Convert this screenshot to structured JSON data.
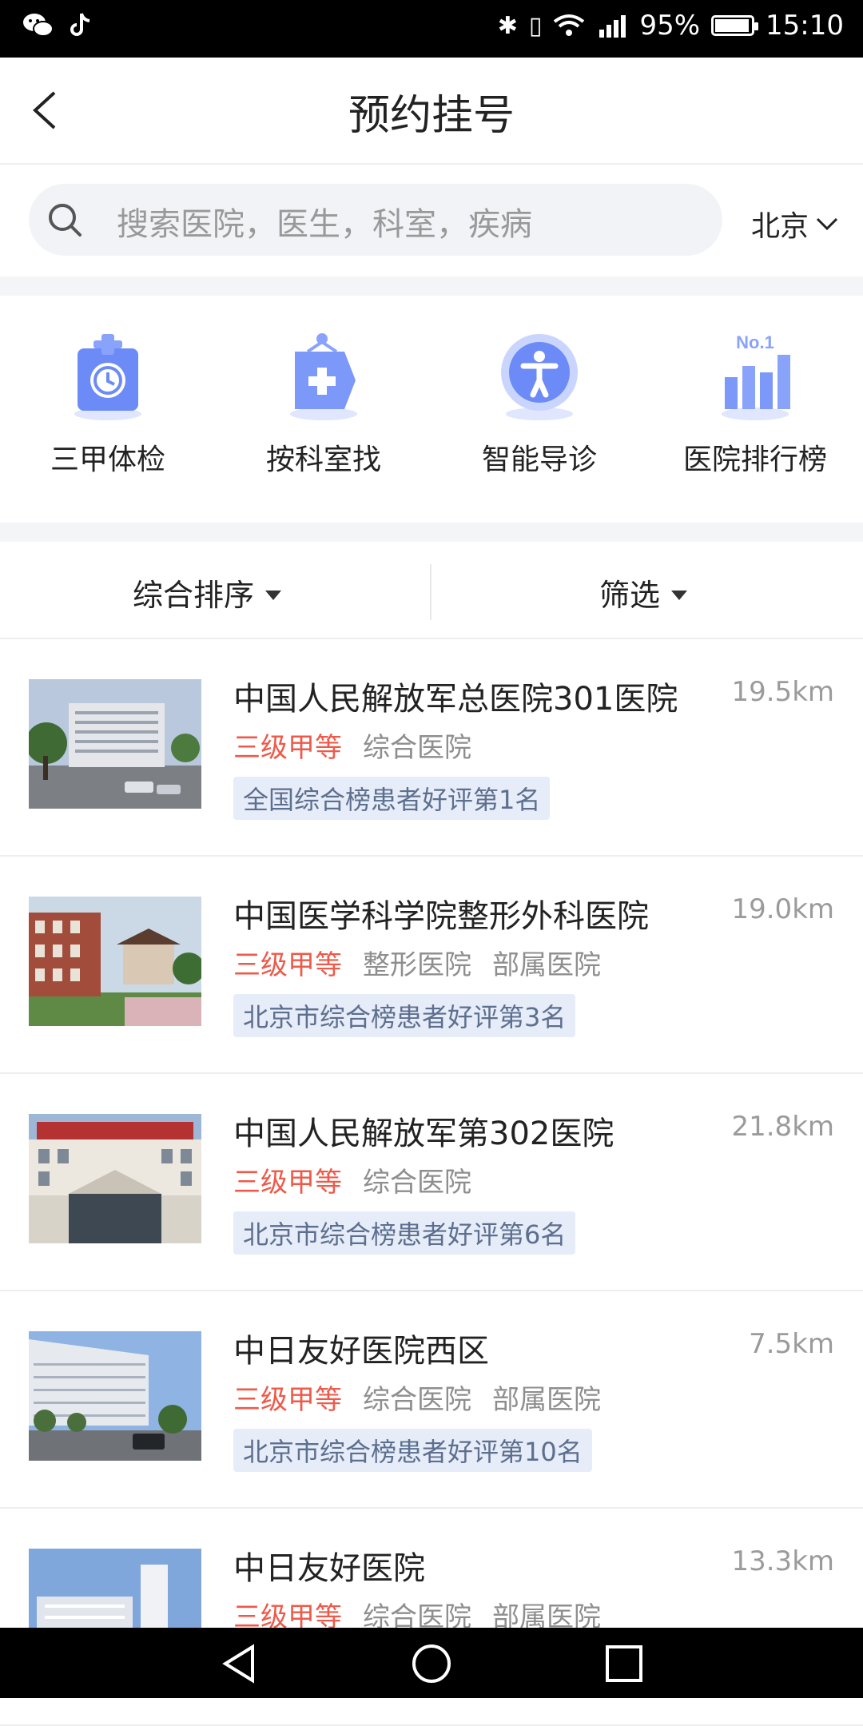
{
  "status_bar": {
    "apps": [
      "wechat-icon",
      "tiktok-icon"
    ],
    "icons": [
      "bluetooth-icon",
      "vibrate-icon",
      "wifi-icon",
      "signal-4g-icon"
    ],
    "battery": "95%",
    "battery_level": 0.95,
    "time": "15:10"
  },
  "header": {
    "title": "预约挂号"
  },
  "search": {
    "placeholder": "搜索医院，医生，科室，疾病",
    "city": "北京"
  },
  "quick_entries": [
    {
      "label": "三甲体检",
      "icon": "clipboard-clock-icon"
    },
    {
      "label": "按科室找",
      "icon": "department-bag-icon"
    },
    {
      "label": "智能导诊",
      "icon": "person-guide-icon"
    },
    {
      "label": "医院排行榜",
      "icon": "ranking-chart-icon",
      "icon_text": "No.1"
    }
  ],
  "sort": {
    "sort_label": "综合排序",
    "filter_label": "筛选"
  },
  "hospitals": [
    {
      "name": "中国人民解放军总医院301医院",
      "distance": "19.5km",
      "level": "三级甲等",
      "tags": [
        "综合医院"
      ],
      "badge": "全国综合榜患者好评第1名"
    },
    {
      "name": "中国医学科学院整形外科医院",
      "distance": "19.0km",
      "level": "三级甲等",
      "tags": [
        "整形医院",
        "部属医院"
      ],
      "badge": "北京市综合榜患者好评第3名"
    },
    {
      "name": "中国人民解放军第302医院",
      "distance": "21.8km",
      "level": "三级甲等",
      "tags": [
        "综合医院"
      ],
      "badge": "北京市综合榜患者好评第6名"
    },
    {
      "name": "中日友好医院西区",
      "distance": "7.5km",
      "level": "三级甲等",
      "tags": [
        "综合医院",
        "部属医院"
      ],
      "badge": "北京市综合榜患者好评第10名"
    },
    {
      "name": "中日友好医院",
      "distance": "13.3km",
      "level": "三级甲等",
      "tags": [
        "综合医院",
        "部属医院"
      ],
      "badge": ""
    }
  ],
  "colors": {
    "accent": "#5b7cf5",
    "level_red": "#ee5a4a",
    "badge_bg": "#e6ecf8"
  },
  "nav": [
    "back-triangle-icon",
    "home-circle-icon",
    "recents-square-icon"
  ]
}
